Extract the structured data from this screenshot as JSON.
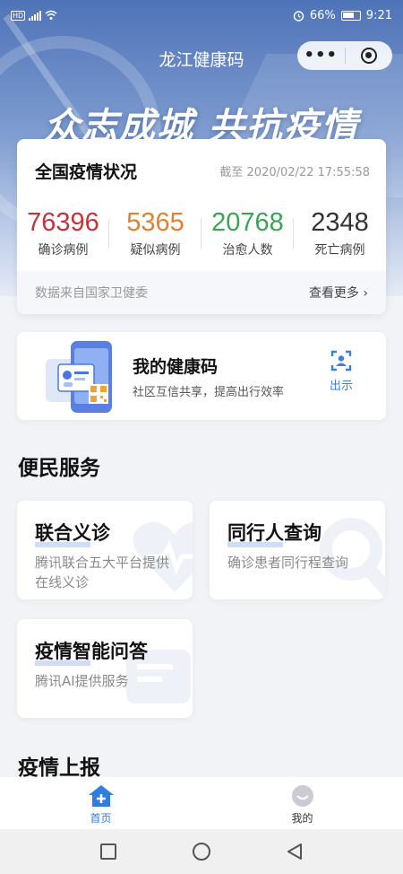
{
  "status_bar": {
    "network_tag": "HD",
    "battery": "66%",
    "time": "9:21"
  },
  "titlebar": {
    "title": "龙江健康码"
  },
  "hero": {
    "slogan": "众志成城 共抗疫情"
  },
  "epidemic": {
    "title": "全国疫情状况",
    "as_of": "截至 2020/02/22 17:55:58",
    "stats": [
      {
        "value": "76396",
        "label": "确诊病例",
        "color": "#c2343a"
      },
      {
        "value": "5365",
        "label": "疑似病例",
        "color": "#e0822b"
      },
      {
        "value": "20768",
        "label": "治愈人数",
        "color": "#3aa457"
      },
      {
        "value": "2348",
        "label": "死亡病例",
        "color": "#333333"
      }
    ],
    "source": "数据来自国家卫健委",
    "more": "查看更多 ›"
  },
  "health_code": {
    "title": "我的健康码",
    "subtitle": "社区互信共享，提高出行效率",
    "show_label": "出示"
  },
  "services": {
    "section_title": "便民服务",
    "items": [
      {
        "title": "联合义诊",
        "desc_line1": "腾讯联合五大平台提供",
        "desc_line2": "在线义诊"
      },
      {
        "title": "同行人查询",
        "desc_line1": "确诊患者同行程查询",
        "desc_line2": ""
      },
      {
        "title": "疫情智能问答",
        "desc_line1": "腾讯AI提供服务",
        "desc_line2": ""
      }
    ]
  },
  "report": {
    "section_title": "疫情上报"
  },
  "tabbar": {
    "home": "首页",
    "mine": "我的"
  },
  "colors": {
    "accent": "#2f7de1",
    "confirmed": "#c2343a",
    "suspected": "#e0822b",
    "cured": "#3aa457"
  }
}
